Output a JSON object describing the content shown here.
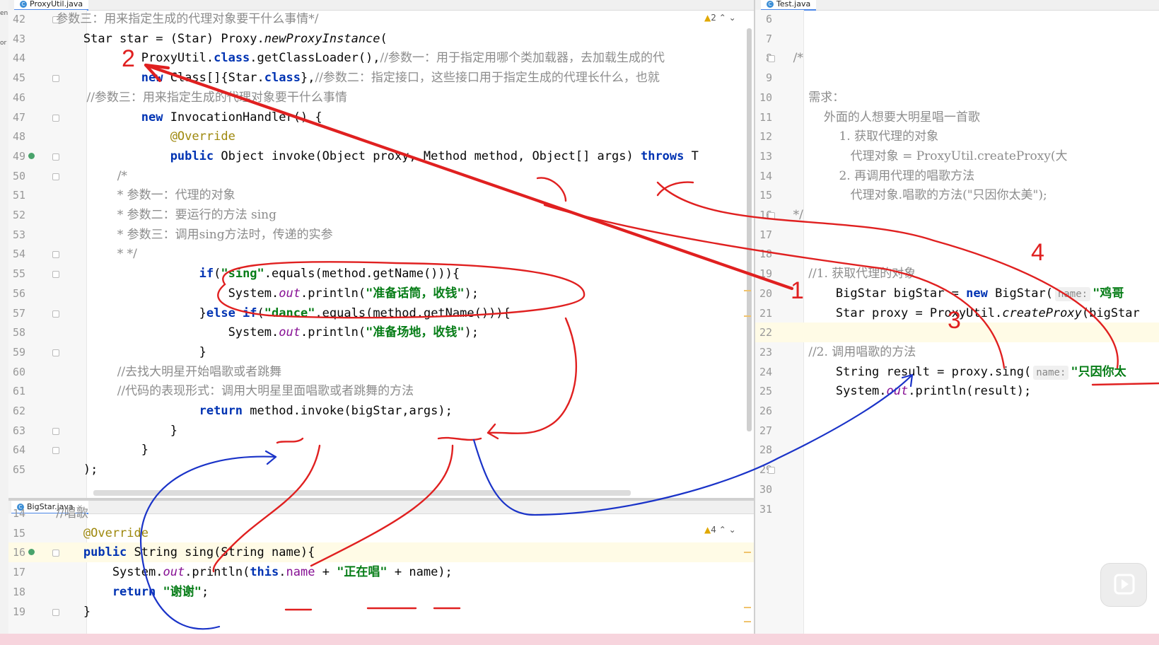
{
  "tabs": {
    "left_top": "ProxyUtil.java",
    "left_bottom": "BigStar.java",
    "right": "Test.java"
  },
  "edge": {
    "a": "en",
    "b": "or"
  },
  "warnings": {
    "top": "2",
    "bottom": "4"
  },
  "annotations": {
    "n1": "1",
    "n2": "2",
    "n3": "3",
    "n4": "4"
  },
  "ui": {
    "close": "×",
    "arrow_up": "⌃",
    "arrow_down": "⌄",
    "tab_icon": "C"
  },
  "proxy_util": [
    {
      "n": "42",
      "t": [
        [
          "cm",
          "        参数三：用来指定生成的代理对象要干什么事情*/"
        ]
      ]
    },
    {
      "n": "43",
      "t": [
        [
          "",
          "        Star star = (Star) Proxy."
        ],
        [
          "it",
          "newProxyInstance"
        ],
        [
          "",
          "("
        ]
      ]
    },
    {
      "n": "44",
      "t": [
        [
          "",
          "                ProxyUtil."
        ],
        [
          "kw",
          "class"
        ],
        [
          "",
          ".getClassLoader(),"
        ],
        [
          "cm",
          "//参数一：用于指定用哪个类加载器，去加载生成的代"
        ]
      ]
    },
    {
      "n": "45",
      "t": [
        [
          "kw",
          "                new"
        ],
        [
          "",
          " Class[]{Star."
        ],
        [
          "kw",
          "class"
        ],
        [
          "",
          "},"
        ],
        [
          "cm",
          "//参数二：指定接口，这些接口用于指定生成的代理长什么，也就"
        ]
      ]
    },
    {
      "n": "46",
      "t": [
        [
          "cm",
          "                //参数三：用来指定生成的代理对象要干什么事情"
        ]
      ]
    },
    {
      "n": "47",
      "t": [
        [
          "kw",
          "                new"
        ],
        [
          "",
          " InvocationHandler() {"
        ]
      ]
    },
    {
      "n": "48",
      "t": [
        [
          "an",
          "                    @Override"
        ]
      ]
    },
    {
      "n": "49",
      "t": [
        [
          "kw",
          "                    public"
        ],
        [
          "",
          " Object invoke(Object proxy, Method method, Object[] args) "
        ],
        [
          "kw",
          "throws"
        ],
        [
          "",
          " T"
        ]
      ]
    },
    {
      "n": "50",
      "t": [
        [
          "cm",
          "                        /*"
        ]
      ]
    },
    {
      "n": "51",
      "t": [
        [
          "cm",
          "                        * 参数一：代理的对象"
        ]
      ]
    },
    {
      "n": "52",
      "t": [
        [
          "cm",
          "                        * 参数二：要运行的方法 sing"
        ]
      ]
    },
    {
      "n": "53",
      "t": [
        [
          "cm",
          "                        * 参数三：调用sing方法时，传递的实参"
        ]
      ]
    },
    {
      "n": "54",
      "t": [
        [
          "cm",
          "                        * */"
        ]
      ]
    },
    {
      "n": "55",
      "t": [
        [
          "kw",
          "                        if"
        ],
        [
          "",
          "("
        ],
        [
          "st",
          "\"sing\""
        ],
        [
          "",
          ".equals(method.getName())){"
        ]
      ]
    },
    {
      "n": "56",
      "t": [
        [
          "",
          "                            System."
        ],
        [
          "fd it",
          "out"
        ],
        [
          "",
          ".println("
        ],
        [
          "st",
          "\"准备话筒，收钱\""
        ],
        [
          "",
          ");"
        ]
      ]
    },
    {
      "n": "57",
      "t": [
        [
          "",
          "                        }"
        ],
        [
          "kw",
          "else if"
        ],
        [
          "",
          "("
        ],
        [
          "st",
          "\"dance\""
        ],
        [
          "",
          ".equals(method.getName())){"
        ]
      ]
    },
    {
      "n": "58",
      "t": [
        [
          "",
          "                            System."
        ],
        [
          "fd it",
          "out"
        ],
        [
          "",
          ".println("
        ],
        [
          "st",
          "\"准备场地，收钱\""
        ],
        [
          "",
          ");"
        ]
      ]
    },
    {
      "n": "59",
      "t": [
        [
          "",
          "                        }"
        ]
      ]
    },
    {
      "n": "60",
      "t": [
        [
          "cm",
          "                        //去找大明星开始唱歌或者跳舞"
        ]
      ]
    },
    {
      "n": "61",
      "t": [
        [
          "cm",
          "                        //代码的表现形式：调用大明星里面唱歌或者跳舞的方法"
        ]
      ]
    },
    {
      "n": "62",
      "t": [
        [
          "kw",
          "                        return"
        ],
        [
          "",
          " method.invoke(bigStar,args);"
        ]
      ]
    },
    {
      "n": "63",
      "t": [
        [
          "",
          "                    }"
        ]
      ]
    },
    {
      "n": "64",
      "t": [
        [
          "",
          "                }"
        ]
      ]
    },
    {
      "n": "65",
      "t": [
        [
          "",
          "        );"
        ]
      ]
    }
  ],
  "big_star": [
    {
      "n": "14",
      "t": [
        [
          "cm",
          "        //唱歌"
        ]
      ]
    },
    {
      "n": "15",
      "t": [
        [
          "an",
          "        @Override"
        ]
      ]
    },
    {
      "n": "16",
      "t": [
        [
          "kw",
          "        public"
        ],
        [
          "",
          " String sing(String name){"
        ]
      ]
    },
    {
      "n": "17",
      "t": [
        [
          "",
          "            System."
        ],
        [
          "fd it",
          "out"
        ],
        [
          "",
          ".println("
        ],
        [
          "kw",
          "this"
        ],
        [
          "",
          "."
        ],
        [
          "fd",
          "name"
        ],
        [
          "",
          " + "
        ],
        [
          "st",
          "\"正在唱\""
        ],
        [
          "",
          " + name);"
        ]
      ]
    },
    {
      "n": "18",
      "t": [
        [
          "kw",
          "            return"
        ],
        [
          "",
          " "
        ],
        [
          "st",
          "\"谢谢\""
        ],
        [
          "",
          ";"
        ]
      ]
    },
    {
      "n": "19",
      "t": [
        [
          "",
          "        }"
        ]
      ]
    }
  ],
  "test": [
    {
      "n": "6",
      "t": []
    },
    {
      "n": "7",
      "t": []
    },
    {
      "n": "8",
      "t": [
        [
          "cm",
          "    /*"
        ]
      ]
    },
    {
      "n": "9",
      "t": []
    },
    {
      "n": "10",
      "t": [
        [
          "cm",
          "        需求："
        ]
      ]
    },
    {
      "n": "11",
      "t": [
        [
          "cm",
          "            外面的人想要大明星唱一首歌"
        ]
      ]
    },
    {
      "n": "12",
      "t": [
        [
          "cm",
          "                1. 获取代理的对象"
        ]
      ]
    },
    {
      "n": "13",
      "t": [
        [
          "cm",
          "                   代理对象 = ProxyUtil.createProxy(大"
        ]
      ]
    },
    {
      "n": "14",
      "t": [
        [
          "cm",
          "                2. 再调用代理的唱歌方法"
        ]
      ]
    },
    {
      "n": "15",
      "t": [
        [
          "cm",
          "                   代理对象.唱歌的方法(\"只因你太美\");"
        ]
      ]
    },
    {
      "n": "16",
      "t": [
        [
          "cm",
          "    */"
        ]
      ]
    },
    {
      "n": "17",
      "t": []
    },
    {
      "n": "18",
      "t": []
    },
    {
      "n": "19",
      "t": [
        [
          "cm",
          "        //1. 获取代理的对象"
        ]
      ]
    },
    {
      "n": "20",
      "t": [
        [
          "",
          "        BigStar bigStar = "
        ],
        [
          "kw",
          "new"
        ],
        [
          "",
          " BigStar("
        ],
        [
          "hint",
          "name:"
        ],
        [
          "st",
          "\"鸡哥"
        ]
      ]
    },
    {
      "n": "21",
      "t": [
        [
          "",
          "        Star proxy = ProxyUtil."
        ],
        [
          "it",
          "createProxy"
        ],
        [
          "",
          "(bigStar"
        ]
      ]
    },
    {
      "n": "22",
      "t": []
    },
    {
      "n": "23",
      "t": [
        [
          "cm",
          "        //2. 调用唱歌的方法"
        ]
      ]
    },
    {
      "n": "24",
      "t": [
        [
          "",
          "        String result = proxy.sing("
        ],
        [
          "hint",
          "name:"
        ],
        [
          "st",
          "\"只因你太"
        ]
      ]
    },
    {
      "n": "25",
      "t": [
        [
          "",
          "        System."
        ],
        [
          "fd it",
          "out"
        ],
        [
          "",
          ".println(result);"
        ]
      ]
    },
    {
      "n": "26",
      "t": []
    },
    {
      "n": "27",
      "t": []
    },
    {
      "n": "28",
      "t": []
    },
    {
      "n": "29",
      "t": []
    },
    {
      "n": "30",
      "t": []
    },
    {
      "n": "31",
      "t": []
    }
  ]
}
